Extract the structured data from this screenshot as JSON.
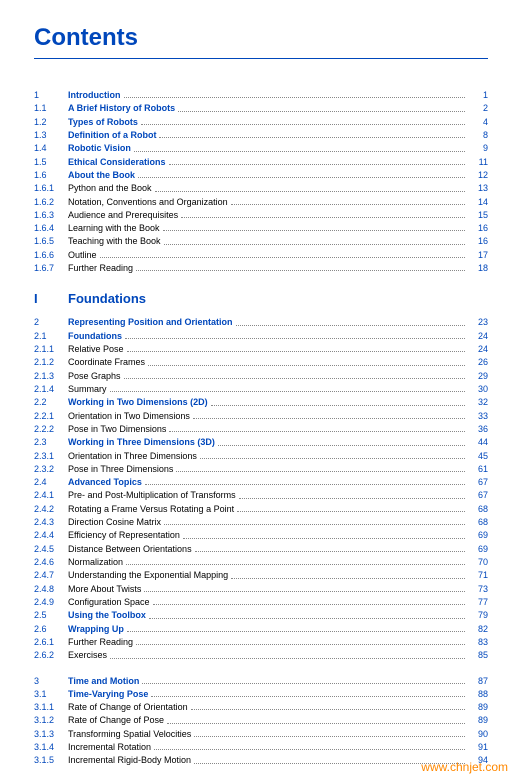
{
  "heading": "Contents",
  "watermark": "www.chnjet.com",
  "entries": [
    {
      "num": "1",
      "title": "Introduction",
      "page": "1",
      "bold": true,
      "blue": true
    },
    {
      "num": "1.1",
      "title": "A Brief History of Robots",
      "page": "2",
      "bold": true,
      "blue": true
    },
    {
      "num": "1.2",
      "title": "Types of Robots",
      "page": "4",
      "bold": true,
      "blue": true
    },
    {
      "num": "1.3",
      "title": "Definition of a Robot",
      "page": "8",
      "bold": true,
      "blue": true
    },
    {
      "num": "1.4",
      "title": "Robotic Vision",
      "page": "9",
      "bold": true,
      "blue": true
    },
    {
      "num": "1.5",
      "title": "Ethical Considerations",
      "page": "11",
      "bold": true,
      "blue": true
    },
    {
      "num": "1.6",
      "title": "About the Book",
      "page": "12",
      "bold": true,
      "blue": true
    },
    {
      "num": "1.6.1",
      "title": "Python and the Book",
      "page": "13",
      "bold": false,
      "blue": false
    },
    {
      "num": "1.6.2",
      "title": "Notation, Conventions and Organization",
      "page": "14",
      "bold": false,
      "blue": false
    },
    {
      "num": "1.6.3",
      "title": "Audience and Prerequisites",
      "page": "15",
      "bold": false,
      "blue": false
    },
    {
      "num": "1.6.4",
      "title": "Learning with the Book",
      "page": "16",
      "bold": false,
      "blue": false
    },
    {
      "num": "1.6.5",
      "title": "Teaching with the Book",
      "page": "16",
      "bold": false,
      "blue": false
    },
    {
      "num": "1.6.6",
      "title": "Outline",
      "page": "17",
      "bold": false,
      "blue": false
    },
    {
      "num": "1.6.7",
      "title": "Further Reading",
      "page": "18",
      "bold": false,
      "blue": false
    }
  ],
  "part": {
    "num": "I",
    "title": "Foundations"
  },
  "entries2": [
    {
      "num": "2",
      "title": "Representing Position and Orientation",
      "page": "23",
      "bold": true,
      "blue": true
    },
    {
      "num": "2.1",
      "title": "Foundations",
      "page": "24",
      "bold": true,
      "blue": true
    },
    {
      "num": "2.1.1",
      "title": "Relative Pose",
      "page": "24",
      "bold": false,
      "blue": false
    },
    {
      "num": "2.1.2",
      "title": "Coordinate Frames",
      "page": "26",
      "bold": false,
      "blue": false
    },
    {
      "num": "2.1.3",
      "title": "Pose Graphs",
      "page": "29",
      "bold": false,
      "blue": false
    },
    {
      "num": "2.1.4",
      "title": "Summary",
      "page": "30",
      "bold": false,
      "blue": false
    },
    {
      "num": "2.2",
      "title": "Working in Two Dimensions (2D)",
      "page": "32",
      "bold": true,
      "blue": true
    },
    {
      "num": "2.2.1",
      "title": "Orientation in Two Dimensions",
      "page": "33",
      "bold": false,
      "blue": false
    },
    {
      "num": "2.2.2",
      "title": "Pose in Two Dimensions",
      "page": "36",
      "bold": false,
      "blue": false
    },
    {
      "num": "2.3",
      "title": "Working in Three Dimensions (3D)",
      "page": "44",
      "bold": true,
      "blue": true
    },
    {
      "num": "2.3.1",
      "title": "Orientation in Three Dimensions",
      "page": "45",
      "bold": false,
      "blue": false
    },
    {
      "num": "2.3.2",
      "title": "Pose in Three Dimensions",
      "page": "61",
      "bold": false,
      "blue": false
    },
    {
      "num": "2.4",
      "title": "Advanced Topics",
      "page": "67",
      "bold": true,
      "blue": true
    },
    {
      "num": "2.4.1",
      "title": "Pre- and Post-Multiplication of Transforms",
      "page": "67",
      "bold": false,
      "blue": false
    },
    {
      "num": "2.4.2",
      "title": "Rotating a Frame Versus Rotating a Point",
      "page": "68",
      "bold": false,
      "blue": false
    },
    {
      "num": "2.4.3",
      "title": "Direction Cosine Matrix",
      "page": "68",
      "bold": false,
      "blue": false
    },
    {
      "num": "2.4.4",
      "title": "Efficiency of Representation",
      "page": "69",
      "bold": false,
      "blue": false
    },
    {
      "num": "2.4.5",
      "title": "Distance Between Orientations",
      "page": "69",
      "bold": false,
      "blue": false
    },
    {
      "num": "2.4.6",
      "title": "Normalization",
      "page": "70",
      "bold": false,
      "blue": false
    },
    {
      "num": "2.4.7",
      "title": "Understanding the Exponential Mapping",
      "page": "71",
      "bold": false,
      "blue": false
    },
    {
      "num": "2.4.8",
      "title": "More About Twists",
      "page": "73",
      "bold": false,
      "blue": false
    },
    {
      "num": "2.4.9",
      "title": "Configuration Space",
      "page": "77",
      "bold": false,
      "blue": false
    },
    {
      "num": "2.5",
      "title": "Using the Toolbox",
      "page": "79",
      "bold": true,
      "blue": true
    },
    {
      "num": "2.6",
      "title": "Wrapping Up",
      "page": "82",
      "bold": true,
      "blue": true
    },
    {
      "num": "2.6.1",
      "title": "Further Reading",
      "page": "83",
      "bold": false,
      "blue": false
    },
    {
      "num": "2.6.2",
      "title": "Exercises",
      "page": "85",
      "bold": false,
      "blue": false
    }
  ],
  "entries3": [
    {
      "num": "3",
      "title": "Time and Motion",
      "page": "87",
      "bold": true,
      "blue": true
    },
    {
      "num": "3.1",
      "title": "Time-Varying Pose",
      "page": "88",
      "bold": true,
      "blue": true
    },
    {
      "num": "3.1.1",
      "title": "Rate of Change of Orientation",
      "page": "89",
      "bold": false,
      "blue": false
    },
    {
      "num": "3.1.2",
      "title": "Rate of Change of Pose",
      "page": "89",
      "bold": false,
      "blue": false
    },
    {
      "num": "3.1.3",
      "title": "Transforming Spatial Velocities",
      "page": "90",
      "bold": false,
      "blue": false
    },
    {
      "num": "3.1.4",
      "title": "Incremental Rotation",
      "page": "91",
      "bold": false,
      "blue": false
    },
    {
      "num": "3.1.5",
      "title": "Incremental Rigid-Body Motion",
      "page": "94",
      "bold": false,
      "blue": false
    }
  ]
}
